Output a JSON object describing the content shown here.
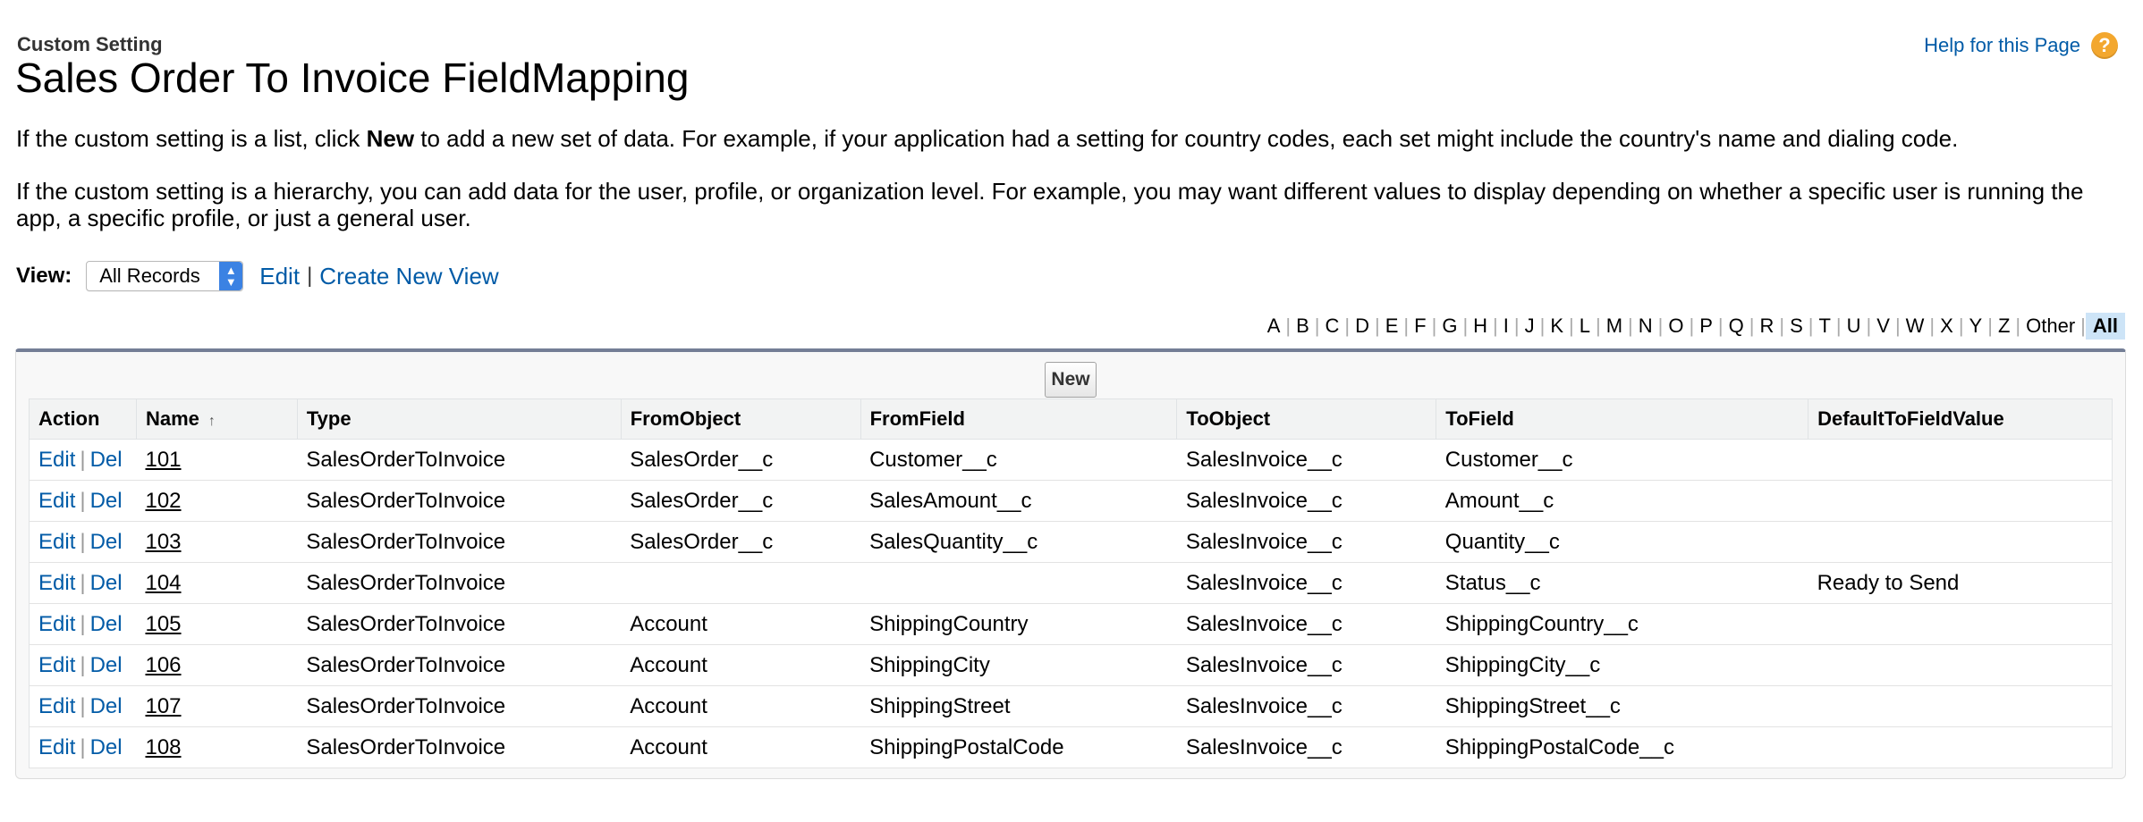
{
  "header": {
    "kicker": "Custom Setting",
    "title": "Sales Order To Invoice FieldMapping",
    "help_label": "Help for this Page",
    "help_icon": "?"
  },
  "description": {
    "p1_before": "If the custom setting is a list, click ",
    "p1_bold": "New",
    "p1_after": " to add a new set of data. For example, if your application had a setting for country codes, each set might include the country's name and dialing code.",
    "p2": "If the custom setting is a hierarchy, you can add data for the user, profile, or organization level. For example, you may want different values to display depending on whether a specific user is running the app, a specific profile, or just a general user."
  },
  "view": {
    "label": "View:",
    "selected": "All Records",
    "edit_label": "Edit",
    "separator": "|",
    "create_label": "Create New View"
  },
  "alphabet": [
    "A",
    "B",
    "C",
    "D",
    "E",
    "F",
    "G",
    "H",
    "I",
    "J",
    "K",
    "L",
    "M",
    "N",
    "O",
    "P",
    "Q",
    "R",
    "S",
    "T",
    "U",
    "V",
    "W",
    "X",
    "Y",
    "Z",
    "Other",
    "All"
  ],
  "alphabet_active": "All",
  "table": {
    "new_button": "New",
    "columns": [
      "Action",
      "Name",
      "Type",
      "FromObject",
      "FromField",
      "ToObject",
      "ToField",
      "DefaultToFieldValue"
    ],
    "sort_indicator": "↑",
    "edit_label": "Edit",
    "del_label": "Del",
    "action_separator": "|",
    "rows": [
      {
        "name": "101",
        "type": "SalesOrderToInvoice",
        "from_object": "SalesOrder__c",
        "from_field": "Customer__c",
        "to_object": "SalesInvoice__c",
        "to_field": "Customer__c",
        "default_value": ""
      },
      {
        "name": "102",
        "type": "SalesOrderToInvoice",
        "from_object": "SalesOrder__c",
        "from_field": "SalesAmount__c",
        "to_object": "SalesInvoice__c",
        "to_field": "Amount__c",
        "default_value": ""
      },
      {
        "name": "103",
        "type": "SalesOrderToInvoice",
        "from_object": "SalesOrder__c",
        "from_field": "SalesQuantity__c",
        "to_object": "SalesInvoice__c",
        "to_field": "Quantity__c",
        "default_value": ""
      },
      {
        "name": "104",
        "type": "SalesOrderToInvoice",
        "from_object": "",
        "from_field": "",
        "to_object": "SalesInvoice__c",
        "to_field": "Status__c",
        "default_value": "Ready to Send"
      },
      {
        "name": "105",
        "type": "SalesOrderToInvoice",
        "from_object": "Account",
        "from_field": "ShippingCountry",
        "to_object": "SalesInvoice__c",
        "to_field": "ShippingCountry__c",
        "default_value": ""
      },
      {
        "name": "106",
        "type": "SalesOrderToInvoice",
        "from_object": "Account",
        "from_field": "ShippingCity",
        "to_object": "SalesInvoice__c",
        "to_field": "ShippingCity__c",
        "default_value": ""
      },
      {
        "name": "107",
        "type": "SalesOrderToInvoice",
        "from_object": "Account",
        "from_field": "ShippingStreet",
        "to_object": "SalesInvoice__c",
        "to_field": "ShippingStreet__c",
        "default_value": ""
      },
      {
        "name": "108",
        "type": "SalesOrderToInvoice",
        "from_object": "Account",
        "from_field": "ShippingPostalCode",
        "to_object": "SalesInvoice__c",
        "to_field": "ShippingPostalCode__c",
        "default_value": ""
      }
    ]
  }
}
